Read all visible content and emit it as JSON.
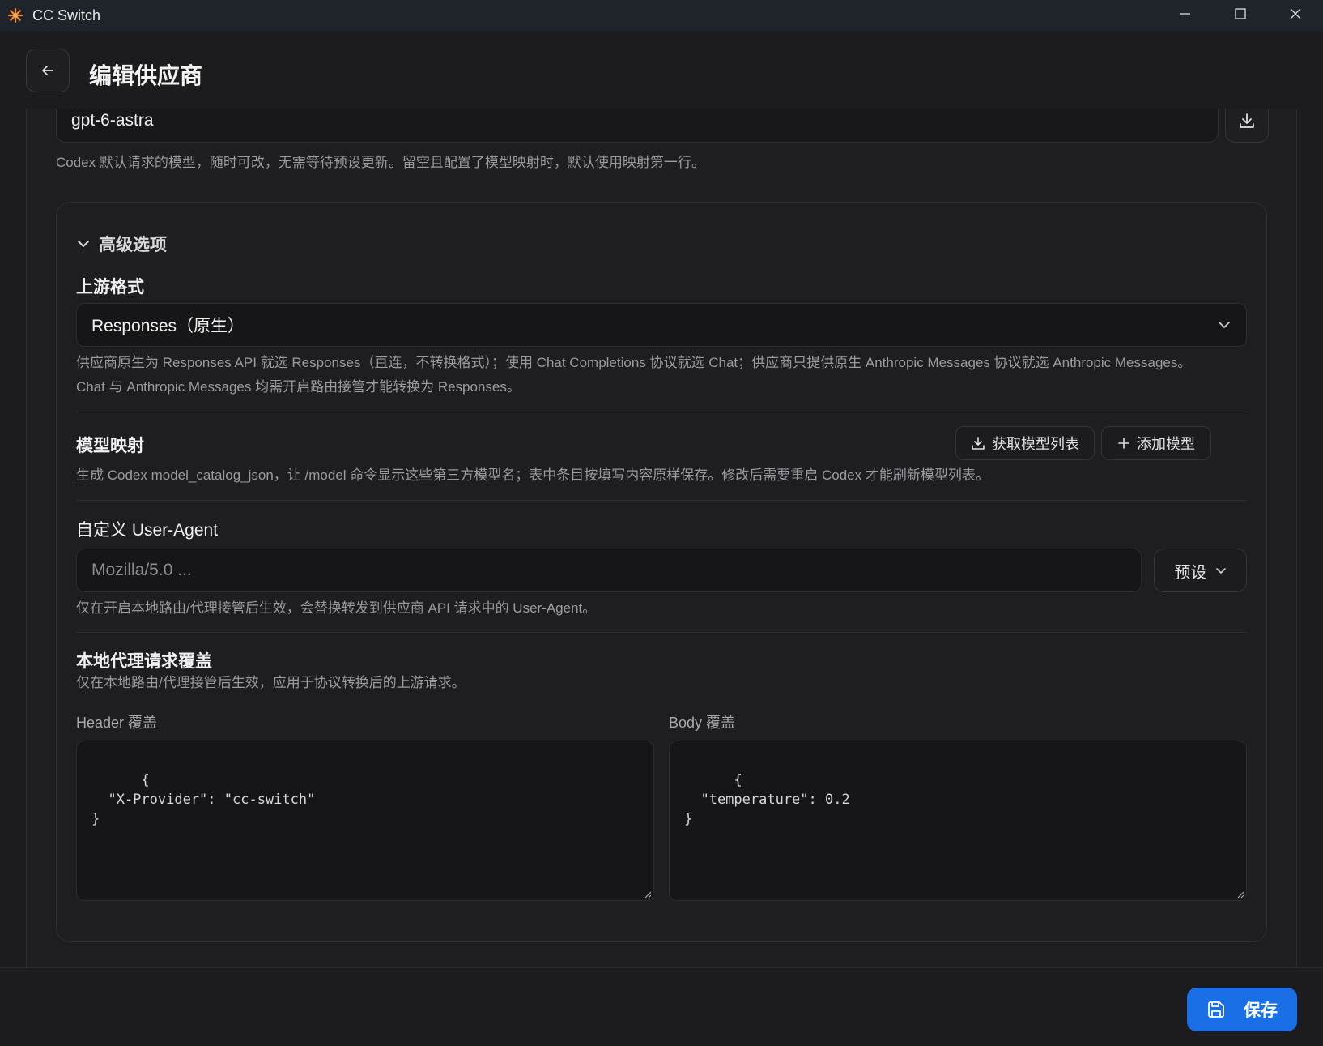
{
  "window": {
    "title": "CC Switch"
  },
  "header": {
    "title": "编辑供应商"
  },
  "model": {
    "value": "gpt-6-astra",
    "hint": "Codex 默认请求的模型，随时可改，无需等待预设更新。留空且配置了模型映射时，默认使用映射第一行。"
  },
  "advanced": {
    "label": "高级选项",
    "upstream": {
      "label": "上游格式",
      "selected": "Responses（原生）",
      "hint_line1": "供应商原生为 Responses API 就选 Responses（直连，不转换格式）；使用 Chat Completions 协议就选 Chat；供应商只提供原生 Anthropic Messages 协议就选 Anthropic Messages。",
      "hint_line2": "Chat 与 Anthropic Messages 均需开启路由接管才能转换为 Responses。"
    },
    "mapping": {
      "label": "模型映射",
      "fetch_label": "获取模型列表",
      "add_label": "添加模型",
      "hint": "生成 Codex model_catalog_json，让 /model 命令显示这些第三方模型名；表中条目按填写内容原样保存。修改后需要重启 Codex 才能刷新模型列表。"
    },
    "user_agent": {
      "label": "自定义 User-Agent",
      "placeholder": "Mozilla/5.0 ...",
      "preset_label": "预设",
      "hint": "仅在开启本地路由/代理接管后生效，会替换转发到供应商 API 请求中的 User-Agent。"
    },
    "override": {
      "label": "本地代理请求覆盖",
      "hint": "仅在本地路由/代理接管后生效，应用于协议转换后的上游请求。",
      "header_label": "Header 覆盖",
      "header_value": "{\n  \"X-Provider\": \"cc-switch\"\n}",
      "body_label": "Body 覆盖",
      "body_value": "{\n  \"temperature\": 0.2\n}"
    }
  },
  "footer": {
    "save_label": "保存"
  },
  "colors": {
    "accent": "#1a6ee6",
    "background": "#1c1c1e"
  }
}
